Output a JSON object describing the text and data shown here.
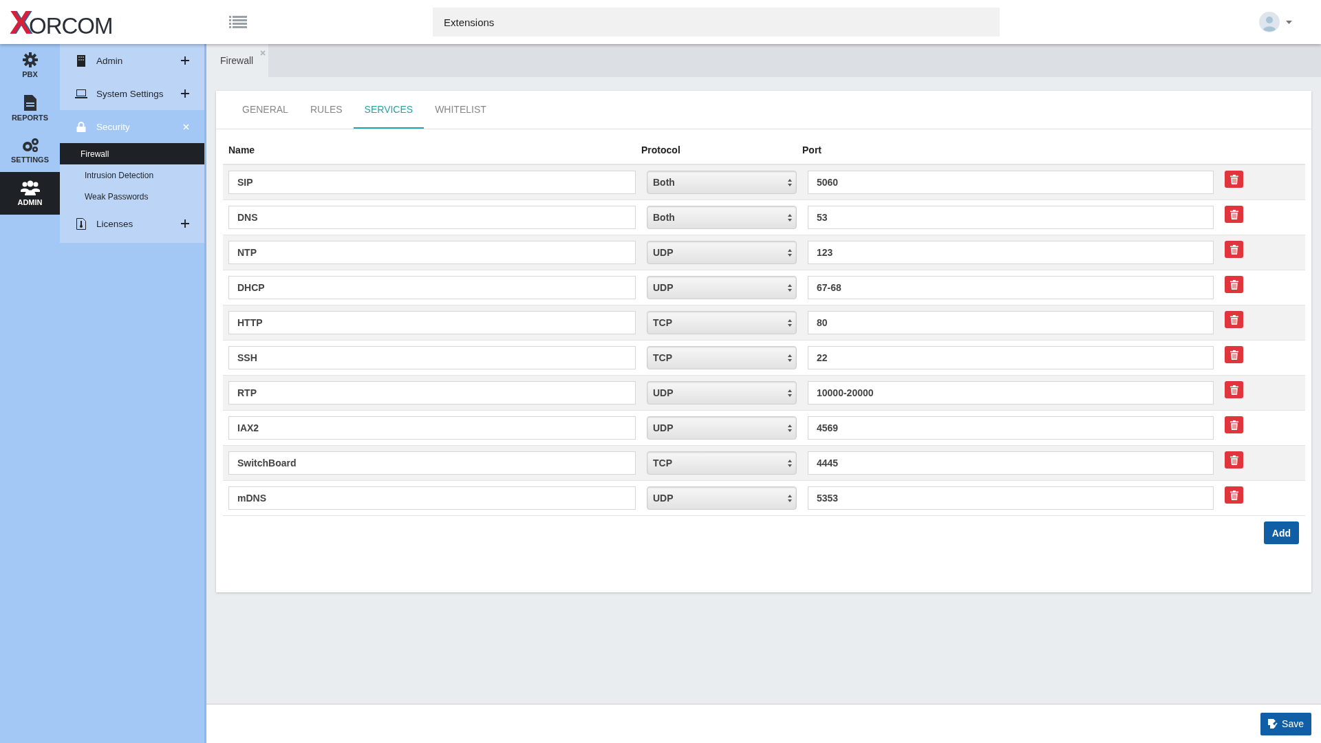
{
  "header": {
    "logo_mark": "X",
    "logo_text": "ORCOM",
    "search": {
      "value": "Extensions"
    }
  },
  "rail": [
    {
      "label": "PBX",
      "selected": false
    },
    {
      "label": "REPORTS",
      "selected": false
    },
    {
      "label": "SETTINGS",
      "selected": false
    },
    {
      "label": "ADMIN",
      "selected": true
    }
  ],
  "menu": [
    {
      "label": "Admin",
      "expanded": false
    },
    {
      "label": "System Settings",
      "expanded": false
    },
    {
      "label": "Security",
      "expanded": true,
      "children": [
        {
          "label": "Firewall",
          "selected": true
        },
        {
          "label": "Intrusion Detection",
          "selected": false
        },
        {
          "label": "Weak Passwords",
          "selected": false
        }
      ]
    },
    {
      "label": "Licenses",
      "expanded": false
    }
  ],
  "page_tabs": [
    {
      "label": "Firewall",
      "selected": true
    }
  ],
  "tabs": [
    {
      "label": "GENERAL",
      "selected": false
    },
    {
      "label": "RULES",
      "selected": false
    },
    {
      "label": "SERVICES",
      "selected": true
    },
    {
      "label": "WHITELIST",
      "selected": false
    }
  ],
  "table": {
    "columns": [
      "Name",
      "Protocol",
      "Port"
    ],
    "rows": [
      {
        "name": "SIP",
        "protocol": "Both",
        "port": "5060"
      },
      {
        "name": "DNS",
        "protocol": "Both",
        "port": "53"
      },
      {
        "name": "NTP",
        "protocol": "UDP",
        "port": "123"
      },
      {
        "name": "DHCP",
        "protocol": "UDP",
        "port": "67-68"
      },
      {
        "name": "HTTP",
        "protocol": "TCP",
        "port": "80"
      },
      {
        "name": "SSH",
        "protocol": "TCP",
        "port": "22"
      },
      {
        "name": "RTP",
        "protocol": "UDP",
        "port": "10000-20000"
      },
      {
        "name": "IAX2",
        "protocol": "UDP",
        "port": "4569"
      },
      {
        "name": "SwitchBoard",
        "protocol": "TCP",
        "port": "4445"
      },
      {
        "name": "mDNS",
        "protocol": "UDP",
        "port": "5353"
      }
    ]
  },
  "add_button": "Add",
  "save_button": "Save"
}
